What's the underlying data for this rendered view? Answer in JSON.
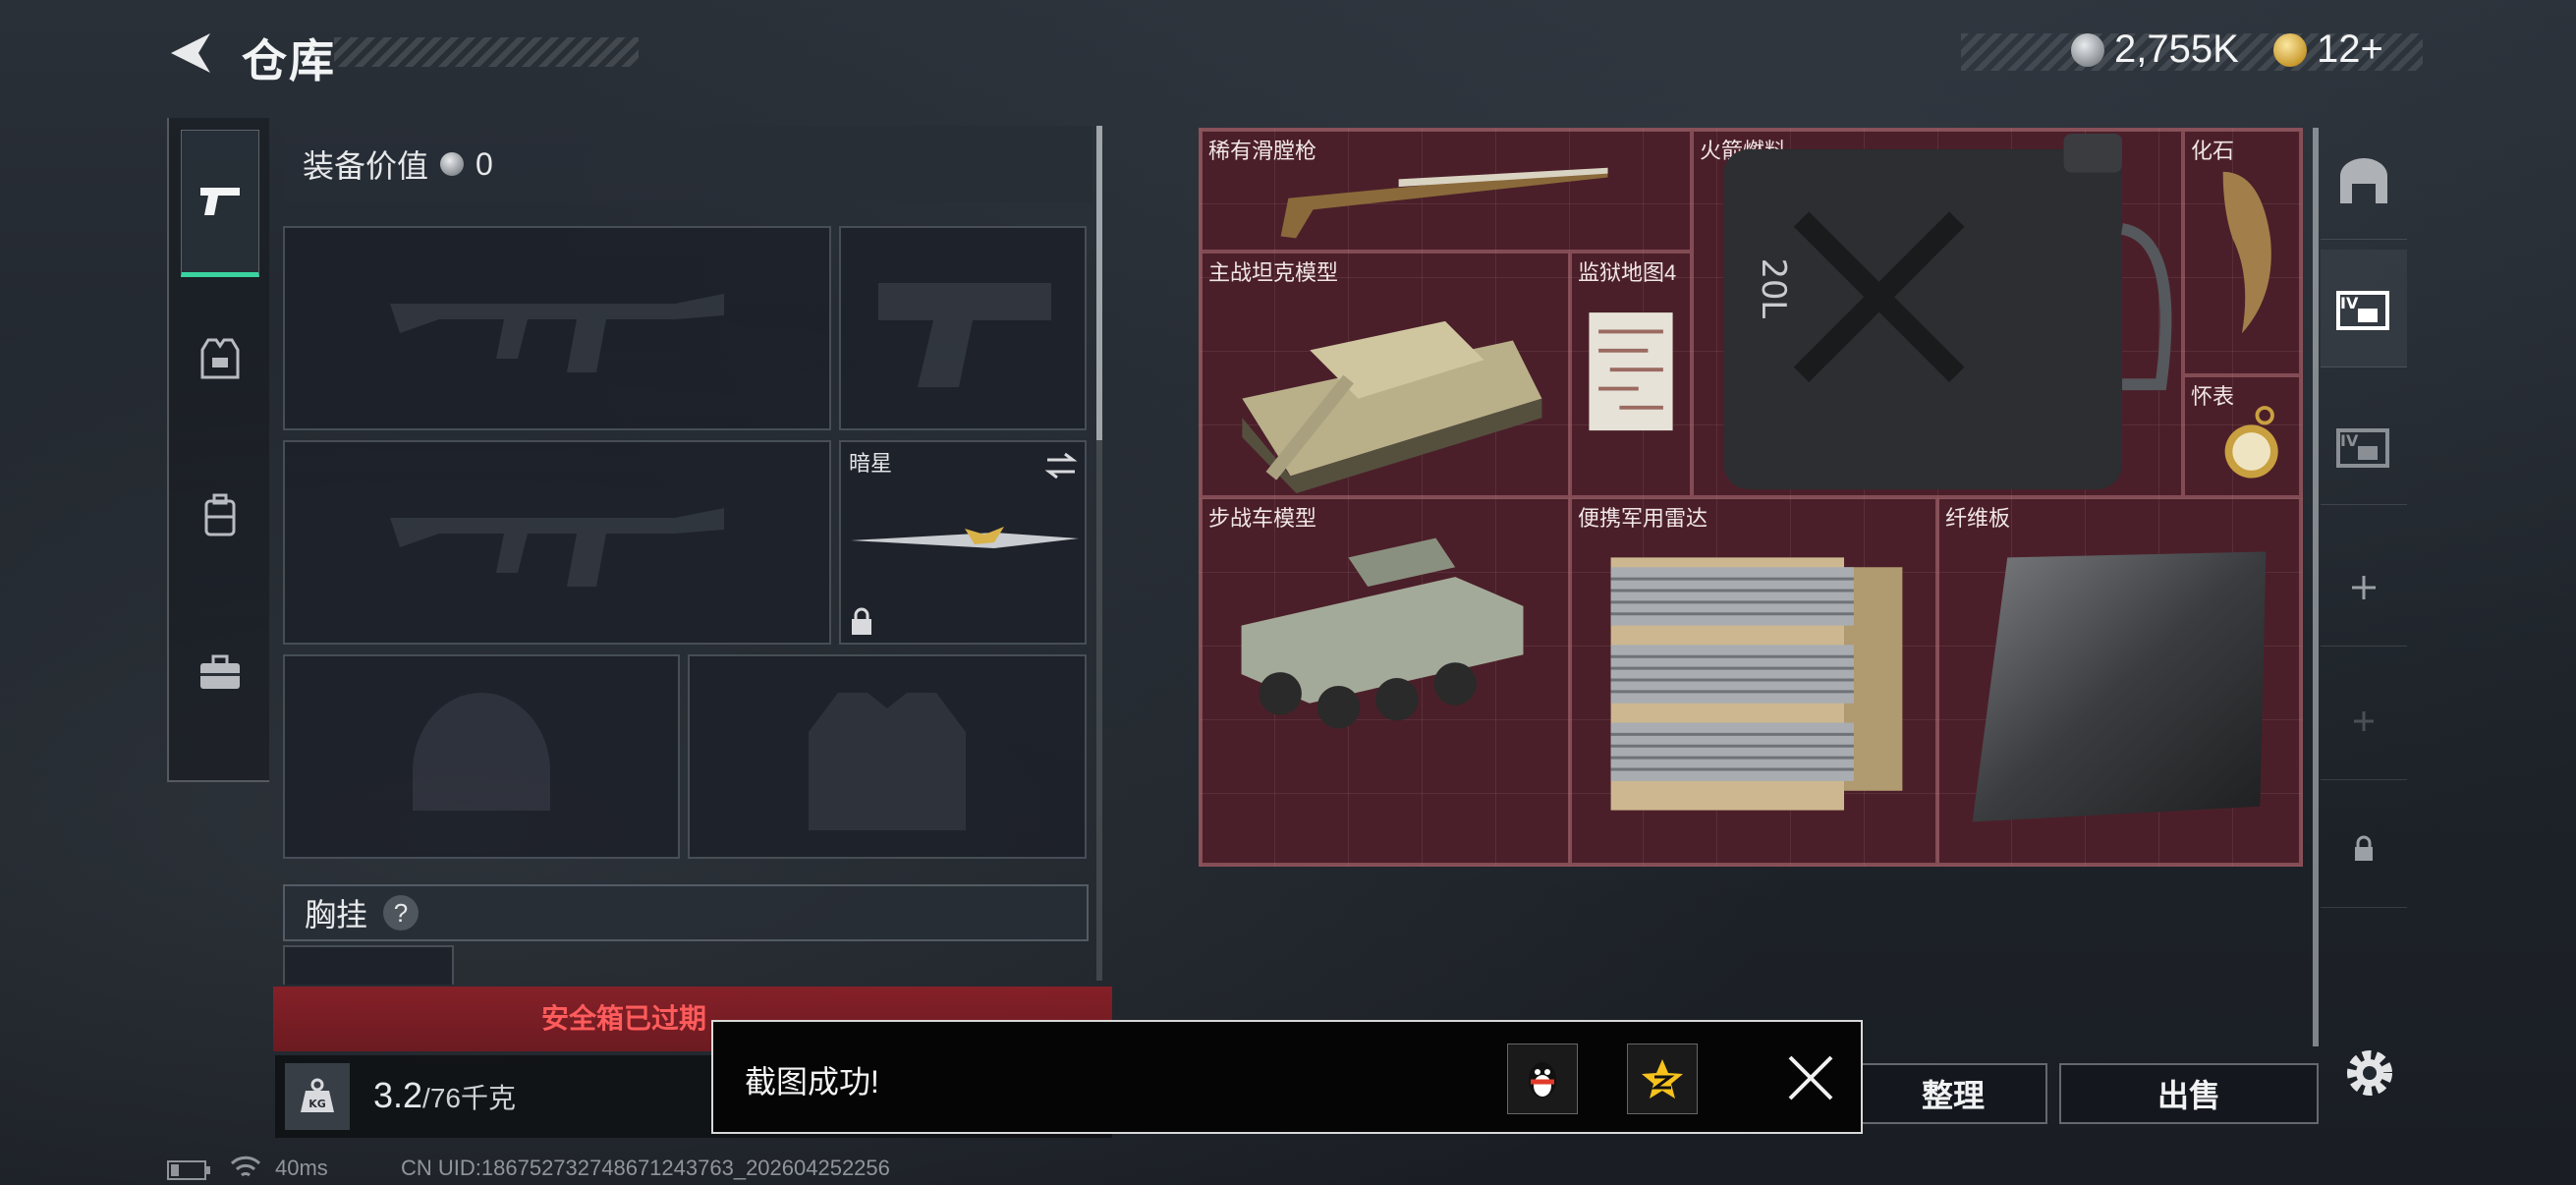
{
  "header": {
    "title": "仓库",
    "currency_silver": "2,755K",
    "currency_gold": "12+"
  },
  "sidebar": {
    "items": [
      {
        "icon": "pistol-icon",
        "active": true
      },
      {
        "icon": "vest-icon",
        "active": false
      },
      {
        "icon": "backpack-icon",
        "active": false
      },
      {
        "icon": "briefcase-icon",
        "active": false
      }
    ]
  },
  "loadout": {
    "value_label": "装备价值",
    "value": "0",
    "melee_label": "暗星",
    "chest_label": "胸挂",
    "chest_help": "?",
    "safe_box_warning": "安全箱已过期",
    "weight_current": "3.2",
    "weight_max": "/76",
    "weight_unit": "千克"
  },
  "stash": {
    "items": [
      {
        "name": "稀有滑膛枪"
      },
      {
        "name": "火箭燃料"
      },
      {
        "name": "化石"
      },
      {
        "name": "主战坦克模型"
      },
      {
        "name": "监狱地图4"
      },
      {
        "name": "怀表"
      },
      {
        "name": "便携军用雷达"
      },
      {
        "name": "纤维板"
      },
      {
        "name": "步战车模型"
      }
    ]
  },
  "actions": {
    "organize": "整理",
    "sell": "出售"
  },
  "toast": {
    "message": "截图成功!"
  },
  "status": {
    "ping": "40ms",
    "uid": "CN UID:18675273274867124376​3_202604252256"
  },
  "colors": {
    "accent_green": "#3ad3a0",
    "stash_bg": "#4b1f29",
    "warning_red": "#ff5c5c"
  }
}
